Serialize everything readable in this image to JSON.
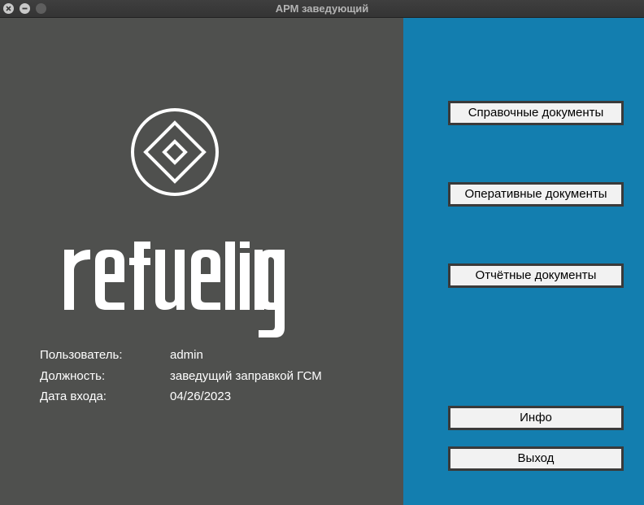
{
  "window": {
    "title": "АРМ заведующий"
  },
  "logo": {
    "wordmark": "refueling",
    "mark_icon": "diamond-in-circle-icon"
  },
  "user_info": [
    {
      "label": "Пользователь:",
      "value": "admin"
    },
    {
      "label": "Должность:",
      "value": "заведущий заправкой ГСМ"
    },
    {
      "label": "Дата входа:",
      "value": "04/26/2023"
    }
  ],
  "menu": {
    "reference_docs": "Справочные документы",
    "operational_docs": "Оперативные документы",
    "report_docs": "Отчётные документы",
    "info": "Инфо",
    "exit": "Выход"
  },
  "colors": {
    "left_panel": "#4f504e",
    "right_panel": "#137eaf",
    "button_face": "#f2f2f2",
    "button_border": "#3a3a3a",
    "text_on_dark": "#ffffff"
  }
}
